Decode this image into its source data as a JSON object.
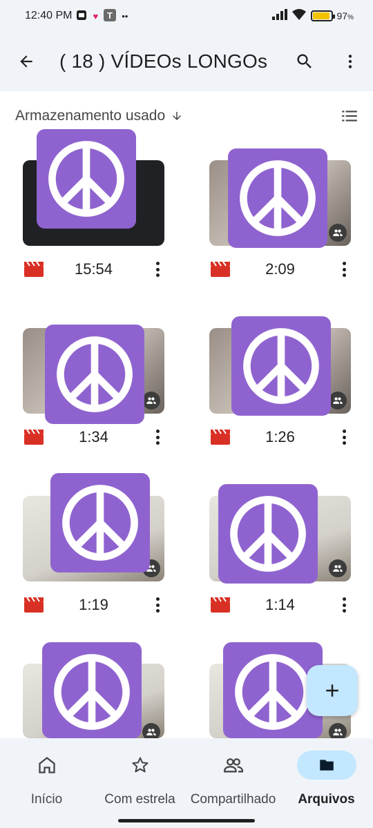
{
  "status_bar": {
    "time": "12:40 PM",
    "battery_percent": "97",
    "battery_suffix": "%",
    "notification_icons": [
      "app-icon",
      "heart-icon",
      "t-app-icon",
      "more-notifications-icon"
    ]
  },
  "app_bar": {
    "title": "( 18 ) VÍDEOs LONGOs",
    "back_icon": "arrow-back-icon",
    "search_icon": "search-icon",
    "more_icon": "more-vert-icon"
  },
  "sort": {
    "label": "Armazenamento usado",
    "direction": "descending",
    "view_icon": "list-view-icon"
  },
  "files": [
    {
      "duration": "15:54",
      "shared": false,
      "thumb_style": "dark"
    },
    {
      "duration": "2:09",
      "shared": true,
      "thumb_style": "photo"
    },
    {
      "duration": "1:34",
      "shared": true,
      "thumb_style": "photo"
    },
    {
      "duration": "1:26",
      "shared": true,
      "thumb_style": "photo"
    },
    {
      "duration": "1:19",
      "shared": true,
      "thumb_style": "light"
    },
    {
      "duration": "1:14",
      "shared": true,
      "thumb_style": "light"
    },
    {
      "duration": "",
      "shared": true,
      "thumb_style": "light"
    },
    {
      "duration": "",
      "shared": true,
      "thumb_style": "light"
    }
  ],
  "fab": {
    "icon": "plus-icon"
  },
  "bottom_nav": {
    "items": [
      {
        "label": "Início",
        "icon": "home-icon",
        "active": false
      },
      {
        "label": "Com estrela",
        "icon": "star-icon",
        "active": false
      },
      {
        "label": "Compartilhado",
        "icon": "people-icon",
        "active": false
      },
      {
        "label": "Arquivos",
        "icon": "folder-icon",
        "active": true
      }
    ]
  },
  "colors": {
    "surface": "#f0f4f9",
    "active_pill": "#c2e7ff",
    "video_icon": "#d93025",
    "overlay_sticker": "#8f63cf"
  }
}
